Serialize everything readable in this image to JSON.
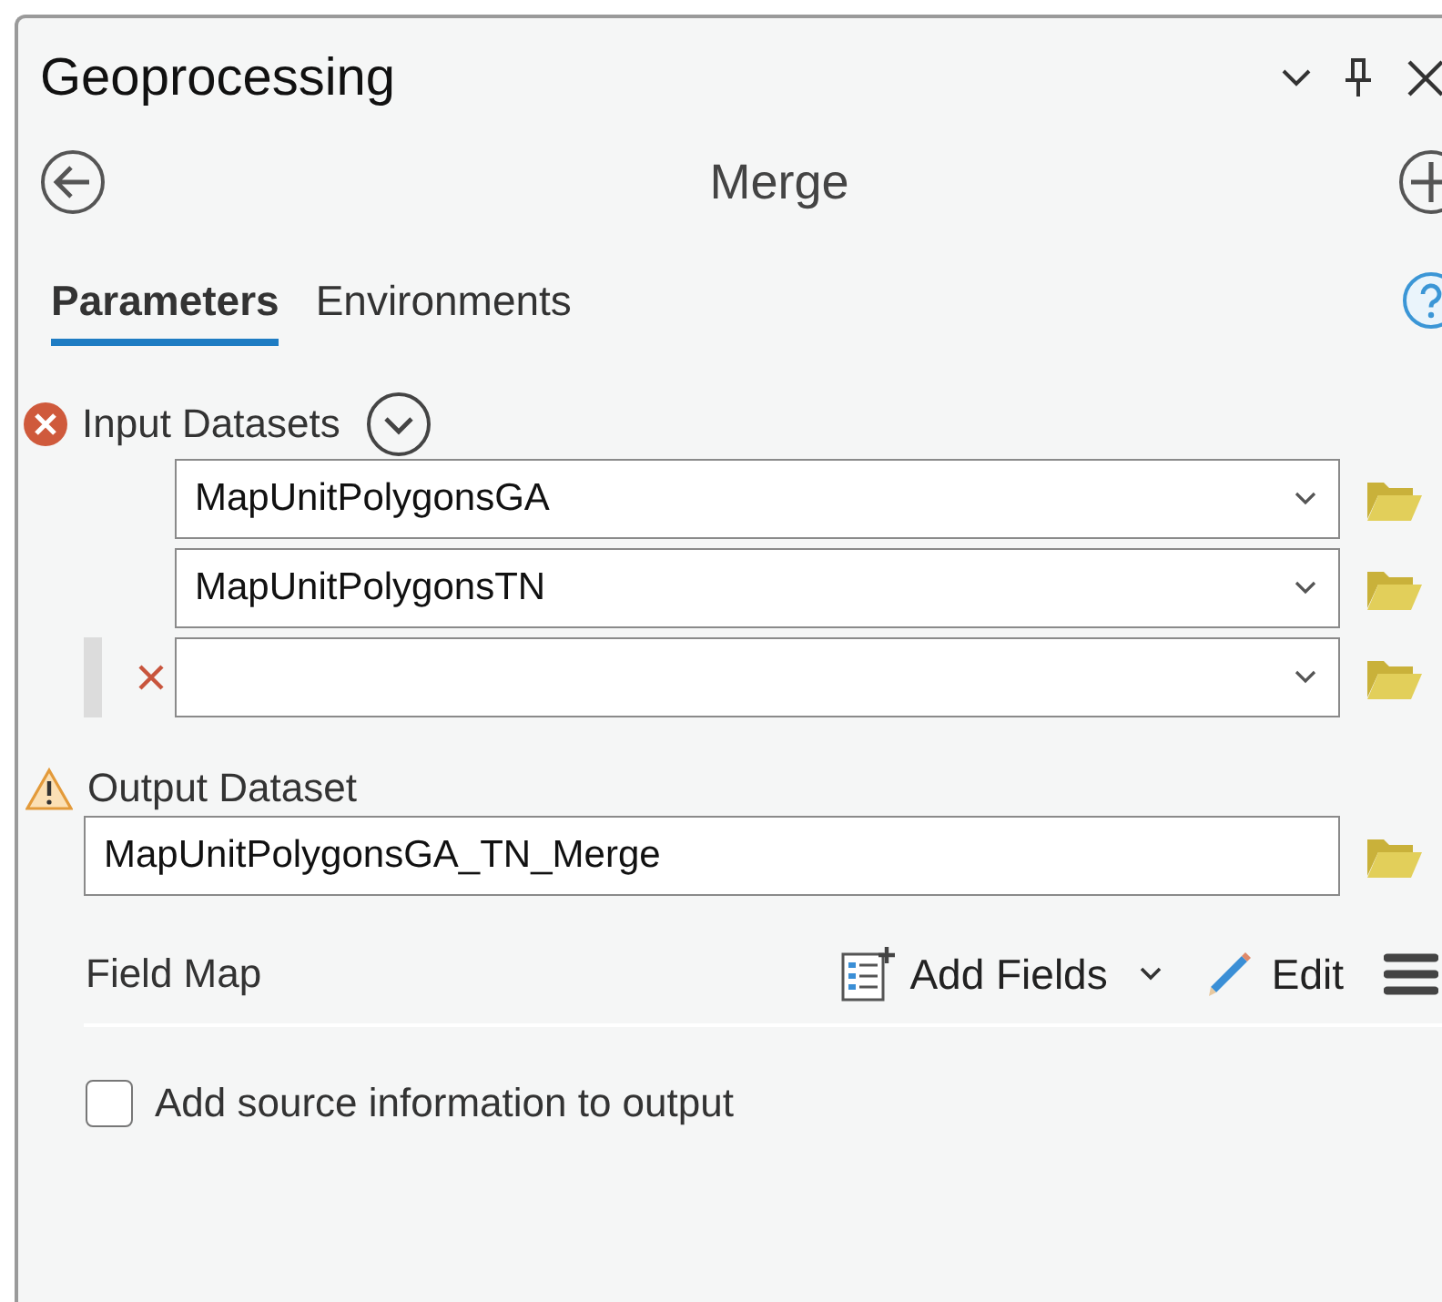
{
  "window": {
    "title": "Geoprocessing"
  },
  "tool": {
    "title": "Merge"
  },
  "tabs": [
    {
      "label": "Parameters",
      "selected": true
    },
    {
      "label": "Environments",
      "selected": false
    }
  ],
  "input_datasets": {
    "label": "Input Datasets",
    "error": true,
    "items": [
      {
        "kind": "entry",
        "value": "MapUnitPolygonsGA"
      },
      {
        "kind": "entry",
        "value": "MapUnitPolygonsTN"
      },
      {
        "kind": "empty"
      }
    ]
  },
  "output_dataset": {
    "label": "Output Dataset",
    "warning": true,
    "value": "MapUnitPolygonsGA_TN_Merge"
  },
  "field_map": {
    "label": "Field Map",
    "add_fields": "Add Fields",
    "edit": "Edit"
  },
  "options": [
    {
      "label": "Add source information to output",
      "checked": false
    }
  ]
}
